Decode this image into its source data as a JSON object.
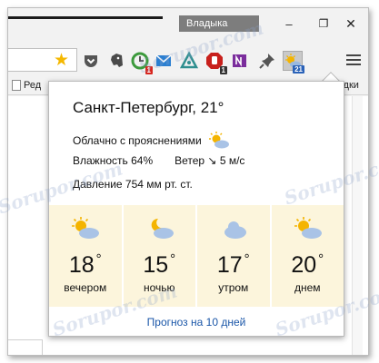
{
  "window": {
    "profile_name": "Владыка",
    "controls": {
      "minimize": "–",
      "maximize": "❐",
      "close": "✕"
    }
  },
  "toolbar": {
    "extensions": [
      {
        "icon": "pocket-icon"
      },
      {
        "icon": "evernote-icon"
      },
      {
        "icon": "clock-icon"
      },
      {
        "icon": "gmail-notifier-icon",
        "badge": "1"
      },
      {
        "icon": "alarm-icon"
      },
      {
        "icon": "hand-stop-icon",
        "badge": "1"
      },
      {
        "icon": "onenote-icon"
      },
      {
        "icon": "pin-icon"
      },
      {
        "icon": "weather-icon",
        "badge": "21"
      }
    ]
  },
  "bookmarks": {
    "left_fragment": "Ред",
    "right_fragment": "ладки"
  },
  "weather": {
    "city_line": "Санкт-Петербург, 21°",
    "condition": "Облачно с прояснениями",
    "humidity": "Влажность 64%",
    "wind": "Ветер ↘ 5 м/с",
    "pressure": "Давление 754 мм рт. ст.",
    "forecast": [
      {
        "temp": "18",
        "deg": "°",
        "label": "вечером",
        "icon": "sun-cloud-icon"
      },
      {
        "temp": "15",
        "deg": "°",
        "label": "ночью",
        "icon": "moon-cloud-icon"
      },
      {
        "temp": "17",
        "deg": "°",
        "label": "утром",
        "icon": "cloud-icon"
      },
      {
        "temp": "20",
        "deg": "°",
        "label": "днем",
        "icon": "sun-cloud-icon"
      }
    ],
    "more_link": "Прогноз на 10 дней"
  },
  "watermark": "Sorupor.com",
  "colors": {
    "forecast_bg": "#fcf5dc",
    "link": "#1a56a8",
    "star": "#f5b800"
  }
}
